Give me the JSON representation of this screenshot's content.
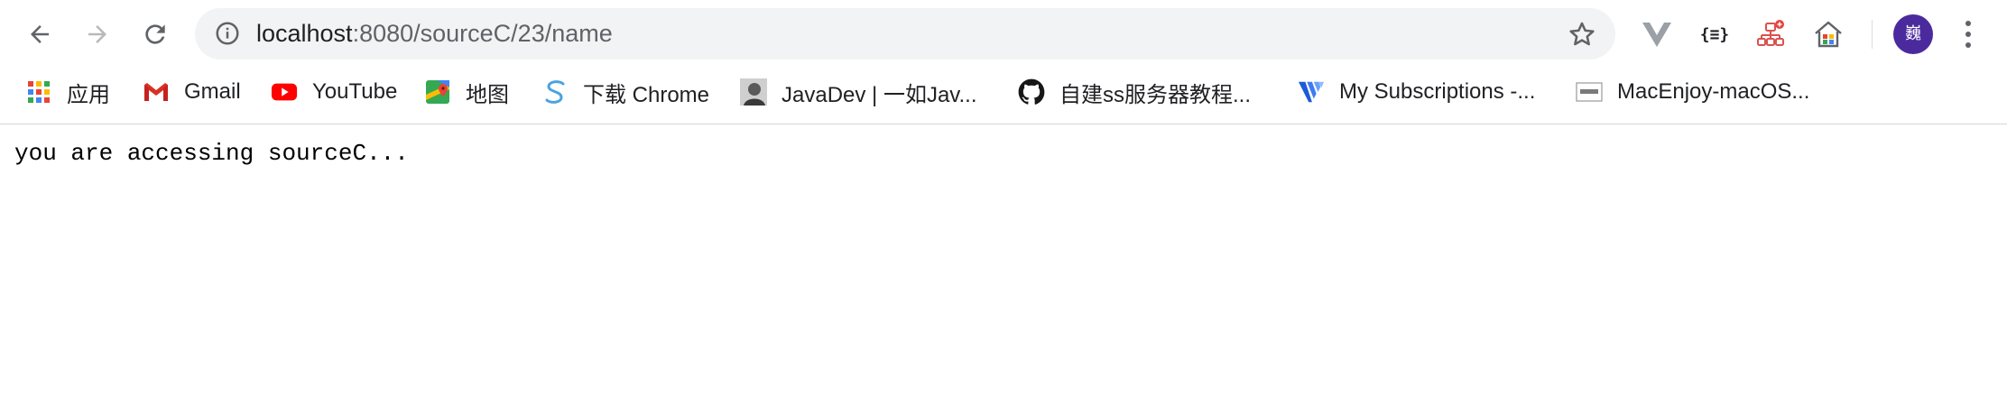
{
  "toolbar": {
    "back_icon": "arrow-left-icon",
    "forward_icon": "arrow-right-icon",
    "reload_icon": "reload-icon",
    "omnibox": {
      "info_icon": "info-icon",
      "url_host": "localhost",
      "url_rest": ":8080/sourceC/23/name",
      "bookmark_icon": "star-icon"
    },
    "extensions": [
      {
        "name": "vue-devtools",
        "icon": "v-icon"
      },
      {
        "name": "json-formatter",
        "icon": "braces-icon",
        "label": "{≡}"
      },
      {
        "name": "sitemap-ext",
        "icon": "sitemap-icon"
      },
      {
        "name": "home-ext",
        "icon": "home-icon"
      }
    ],
    "avatar_text": "巍",
    "menu_icon": "kebab-menu-icon"
  },
  "bookmarks": [
    {
      "label": "应用",
      "icon": "apps-grid-icon"
    },
    {
      "label": "Gmail",
      "icon": "gmail-icon"
    },
    {
      "label": "YouTube",
      "icon": "youtube-icon"
    },
    {
      "label": "地图",
      "icon": "maps-icon"
    },
    {
      "label": "下载 Chrome",
      "icon": "chrome-download-icon"
    },
    {
      "label": "JavaDev | 一如Jav...",
      "icon": "javadev-avatar-icon"
    },
    {
      "label": "自建ss服务器教程...",
      "icon": "github-icon"
    },
    {
      "label": "My Subscriptions -...",
      "icon": "vultr-icon"
    },
    {
      "label": "MacEnjoy-macOS...",
      "icon": "macenjoy-icon"
    }
  ],
  "page": {
    "body_text": "you are accessing sourceC..."
  },
  "colors": {
    "omnibox_bg": "#f1f3f4",
    "avatar_bg": "#4b2a9e",
    "youtube_red": "#ff0000",
    "gmail_red": "#d93025",
    "vultr_blue": "#2b6cee"
  }
}
